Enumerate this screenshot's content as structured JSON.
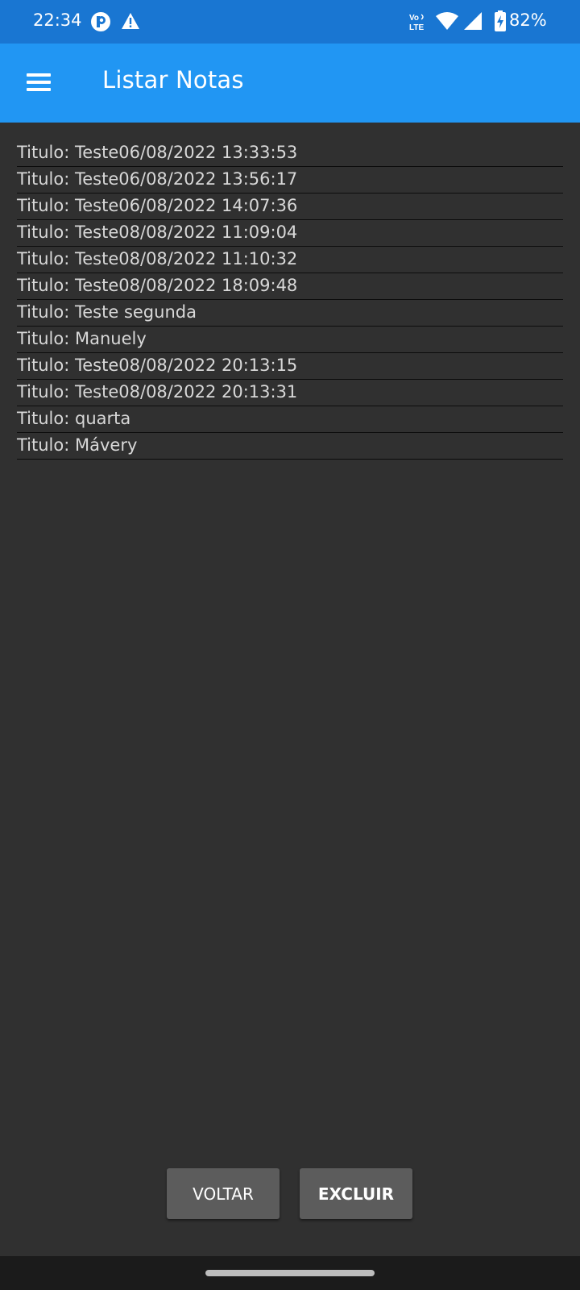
{
  "status_bar": {
    "time": "22:34",
    "battery_percent": "82%",
    "network_label": "Vo LTE",
    "icons": [
      "app-notification-icon",
      "warning-icon",
      "volte-icon",
      "wifi-icon",
      "cell-signal-icon",
      "battery-charging-icon"
    ]
  },
  "app_bar": {
    "title": "Listar Notas",
    "menu_icon": "hamburger-menu-icon",
    "background": "#2196f3"
  },
  "notes": [
    {
      "label": "Titulo: Teste06/08/2022 13:33:53"
    },
    {
      "label": "Titulo: Teste06/08/2022 13:56:17"
    },
    {
      "label": "Titulo: Teste06/08/2022 14:07:36"
    },
    {
      "label": "Titulo: Teste08/08/2022 11:09:04"
    },
    {
      "label": "Titulo: Teste08/08/2022 11:10:32"
    },
    {
      "label": "Titulo: Teste08/08/2022 18:09:48"
    },
    {
      "label": "Titulo: Teste segunda"
    },
    {
      "label": "Titulo: Manuely"
    },
    {
      "label": "Titulo: Teste08/08/2022 20:13:15"
    },
    {
      "label": "Titulo: Teste08/08/2022 20:13:31"
    },
    {
      "label": "Titulo: quarta"
    },
    {
      "label": "Titulo: Mávery"
    }
  ],
  "buttons": {
    "back_label": "VOLTAR",
    "delete_label": "EXCLUIR"
  },
  "colors": {
    "status_bar": "#1976d2",
    "app_bar": "#2196f3",
    "background": "#303030",
    "button": "#5c5c5c"
  }
}
